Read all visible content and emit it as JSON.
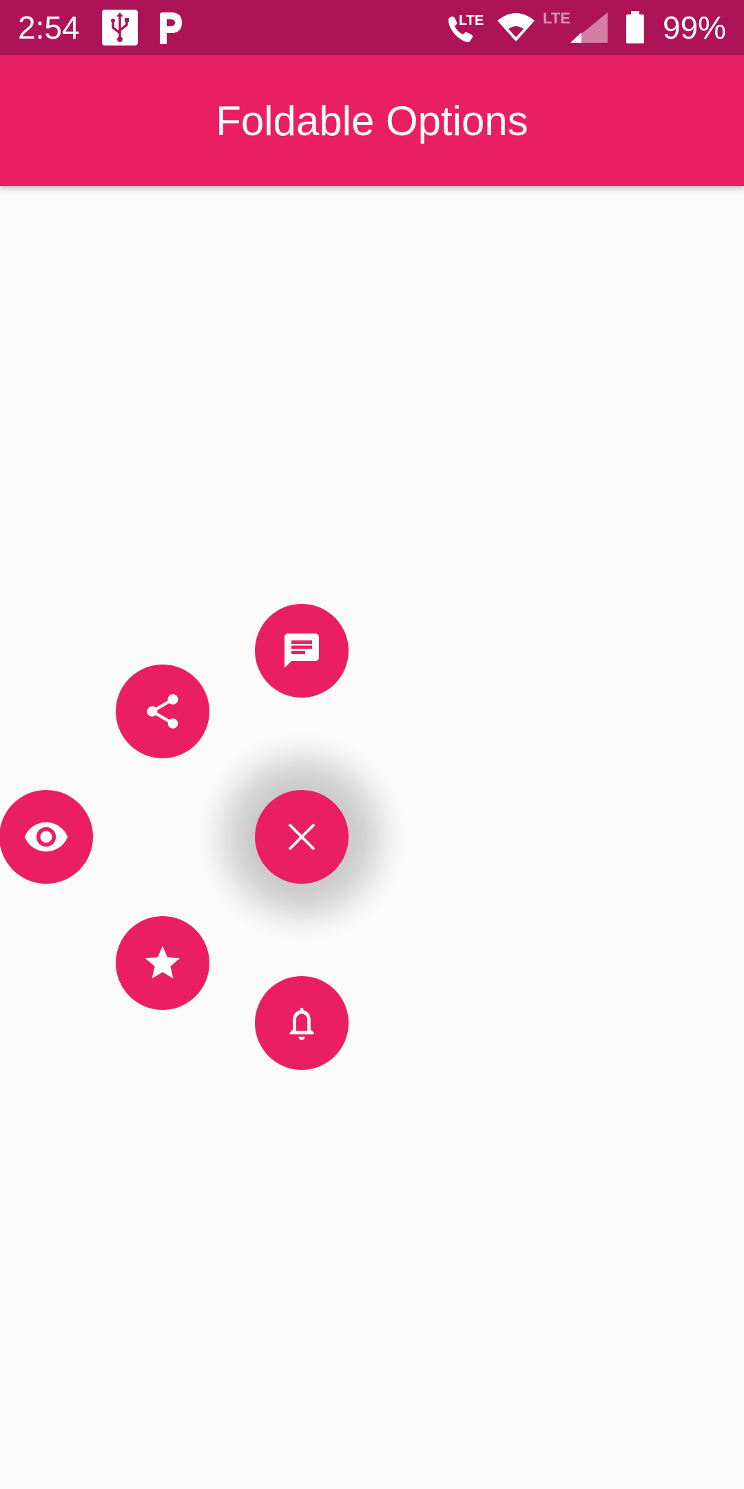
{
  "status_bar": {
    "time": "2:54",
    "battery_percent": "99%",
    "icons": [
      "usb-icon",
      "parking-app-icon",
      "lte-call-icon",
      "wifi-icon",
      "lte-signal-icon",
      "battery-icon"
    ],
    "network_label": "LTE",
    "background_color": "#ad1457"
  },
  "app_bar": {
    "title": "Foldable Options",
    "background_color": "#e91e63"
  },
  "fab_menu": {
    "state": "expanded",
    "accent_color": "#e91e63",
    "main_button_icon": "close-icon",
    "options": [
      {
        "icon": "message-icon"
      },
      {
        "icon": "share-icon"
      },
      {
        "icon": "eye-icon"
      },
      {
        "icon": "star-icon"
      },
      {
        "icon": "bell-icon"
      }
    ]
  }
}
